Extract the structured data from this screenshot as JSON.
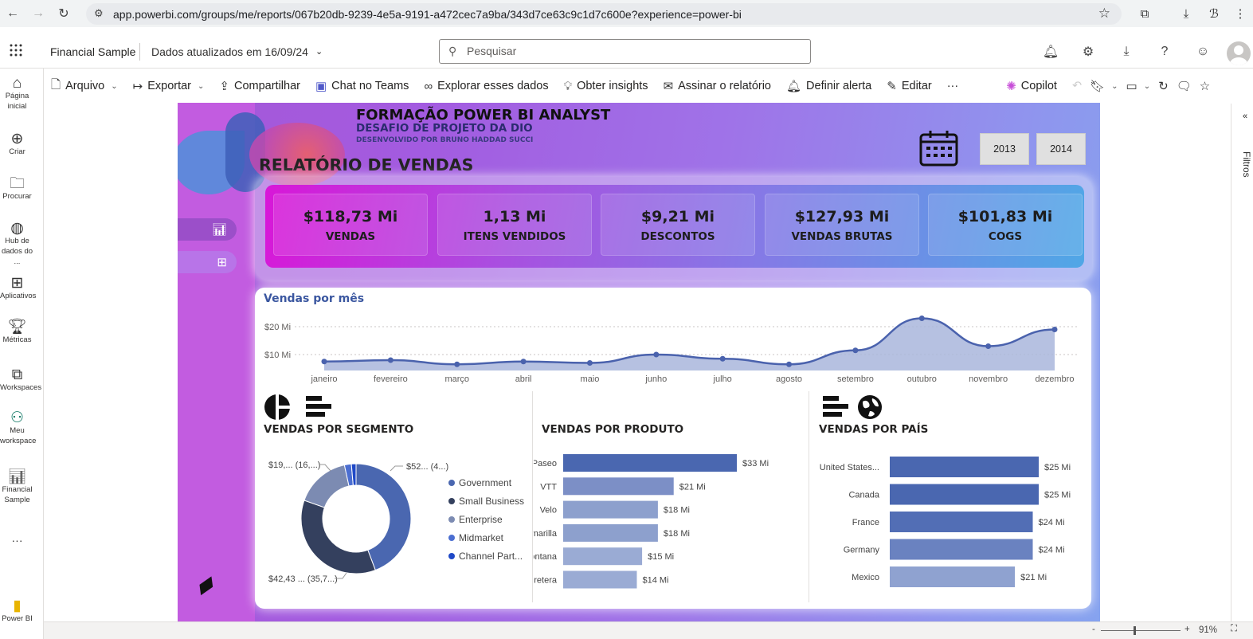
{
  "browser": {
    "url": "app.powerbi.com/groups/me/reports/067b20db-9239-4e5a-9191-a472cec7a9ba/343d7ce63c9c1d7c600e?experience=power-bi"
  },
  "header": {
    "report_name": "Financial Sample",
    "refresh_text": "Dados atualizados em 16/09/24",
    "search_placeholder": "Pesquisar"
  },
  "toolbar": {
    "arquivo": "Arquivo",
    "exportar": "Exportar",
    "compartilhar": "Compartilhar",
    "chat": "Chat no Teams",
    "explorar": "Explorar esses dados",
    "insights": "Obter insights",
    "assinar": "Assinar o relatório",
    "alerta": "Definir alerta",
    "editar": "Editar",
    "more": "···",
    "copilot": "Copilot"
  },
  "leftnav": {
    "home": [
      "Página",
      "inicial"
    ],
    "criar": "Criar",
    "procurar": "Procurar",
    "hub": [
      "Hub de",
      "dados do ..."
    ],
    "apps": "Aplicativos",
    "metricas": "Métricas",
    "workspaces": "Workspaces",
    "meu": [
      "Meu",
      "workspace"
    ],
    "financial": [
      "Financial",
      "Sample"
    ],
    "more": "···",
    "powerbi": "Power BI"
  },
  "report": {
    "title1": "FORMAÇÃO POWER BI ANALYST",
    "title2": "DESAFIO DE PROJETO DA DIO",
    "title3": "DESENVOLVIDO POR BRUNO HADDAD SUCCI",
    "main_title": "RELATÓRIO DE VENDAS",
    "year1": "2013",
    "year2": "2014"
  },
  "kpis": [
    {
      "value": "$118,73 Mi",
      "label": "VENDAS"
    },
    {
      "value": "1,13 Mi",
      "label": "ITENS VENDIDOS"
    },
    {
      "value": "$9,21 Mi",
      "label": "DESCONTOS"
    },
    {
      "value": "$127,93 Mi",
      "label": "VENDAS BRUTAS"
    },
    {
      "value": "$101,83 Mi",
      "label": "COGS"
    }
  ],
  "filters_label": "Filtros",
  "status": {
    "zoom": "91%"
  },
  "chart_data": [
    {
      "type": "area",
      "title": "Vendas por mês",
      "y_ticks": [
        "$10 Mi",
        "$20 Mi"
      ],
      "ylim": [
        0,
        20
      ],
      "categories": [
        "janeiro",
        "fevereiro",
        "março",
        "abril",
        "maio",
        "junho",
        "julho",
        "agosto",
        "setembro",
        "outubro",
        "novembro",
        "dezembro"
      ],
      "values": [
        7.5,
        8.0,
        6.5,
        7.5,
        7.0,
        10.0,
        8.5,
        6.5,
        11.5,
        23.0,
        13.0,
        19.0
      ],
      "color": "#4a62ad"
    },
    {
      "type": "pie",
      "title": "VENDAS POR SEGMENTO",
      "categories": [
        "Government",
        "Small Business",
        "Enterprise",
        "Midmarket",
        "Channel Part..."
      ],
      "values": [
        52,
        42.43,
        19,
        2.4,
        1.6
      ],
      "data_labels": [
        "$52... (4...)",
        "$42,43 ... (35,7...)",
        "$19,... (16,...)"
      ],
      "colors": [
        "#4a67b0",
        "#34405e",
        "#7c8bb2",
        "#4b6ed1",
        "#1f49c7"
      ]
    },
    {
      "type": "bar",
      "title": "VENDAS POR PRODUTO",
      "categories": [
        "Paseo",
        "VTT",
        "Velo",
        "Amarilla",
        "Montana",
        "Carretera"
      ],
      "values": [
        33,
        21,
        18,
        18,
        15,
        14
      ],
      "data_labels": [
        "$33 Mi",
        "$21 Mi",
        "$18 Mi",
        "$18 Mi",
        "$15 Mi",
        "$14 Mi"
      ],
      "colors": [
        "#4a67b0",
        "#7c8fc6",
        "#8da0cd",
        "#8da0cd",
        "#9aabd4",
        "#9aabd4"
      ]
    },
    {
      "type": "bar",
      "title": "VENDAS POR PAÍS",
      "categories": [
        "United States...",
        "Canada",
        "France",
        "Germany",
        "Mexico"
      ],
      "values": [
        25,
        25,
        24,
        24,
        21
      ],
      "data_labels": [
        "$25 Mi",
        "$25 Mi",
        "$24 Mi",
        "$24 Mi",
        "$21 Mi"
      ],
      "colors": [
        "#4a67b0",
        "#4a67b0",
        "#526eb5",
        "#6a82c0",
        "#8fa2d0"
      ]
    }
  ]
}
